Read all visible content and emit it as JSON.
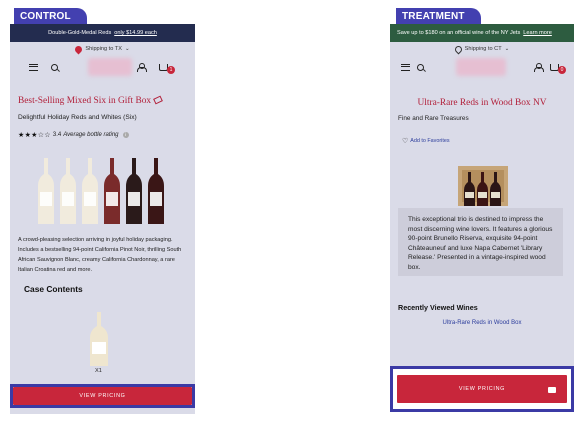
{
  "labels": {
    "control": "CONTROL",
    "treatment": "TREATMENT"
  },
  "control": {
    "promo_text": "Double-Gold-Medal Reds",
    "promo_link": "only $14.99 each",
    "shipping": "Shipping to TX",
    "cart_count": "1",
    "title": "Best-Selling Mixed Six in Gift Box",
    "subtitle": "Delightful Holiday Reds and Whites (Six)",
    "rating_stars": "★★★☆☆",
    "rating_value": "3.4",
    "rating_label": "Average bottle rating",
    "description": "A crowd-pleasing selection arriving in joyful holiday packaging. Includes a bestselling 94-point California Pinot Noir, thrilling South African Sauvignon Blanc, creamy California Chardonnay, a rare Italian Croatina red and more.",
    "case_title": "Case Contents",
    "qty": "X1",
    "cta": "VIEW PRICING"
  },
  "treatment": {
    "promo_text": "Save up to $180 on an official wine of the NY Jets",
    "promo_link": "Learn more",
    "shipping": "Shipping to CT",
    "cart_count": "0",
    "title": "Ultra-Rare Reds in Wood Box NV",
    "subtitle": "Fine and Rare Treasures",
    "favorite": "Add to Favorites",
    "description": "This exceptional trio is destined to impress the most discerning wine lovers. It features a glorious 90-point Brunello Riserva, exquisite 94-point Châteauneuf and luxe Napa Cabernet 'Library Release.' Presented in a vintage-inspired wood box.",
    "recent_title": "Recently Viewed Wines",
    "recent_link": "Ultra-Rare Reds in Wood Box",
    "cta": "VIEW PRICING"
  },
  "colors": {
    "label_bg": "#4340b0",
    "control_promo_bg": "#232c4f",
    "treatment_promo_bg": "#2d5c40",
    "accent_red": "#c8263b",
    "title_red": "#b2203a",
    "frame_blue": "#3b3aa5"
  },
  "icons": [
    "map-pin-icon",
    "hamburger-icon",
    "search-icon",
    "user-icon",
    "cart-icon",
    "gift-icon",
    "info-icon",
    "heart-icon",
    "chat-icon"
  ]
}
